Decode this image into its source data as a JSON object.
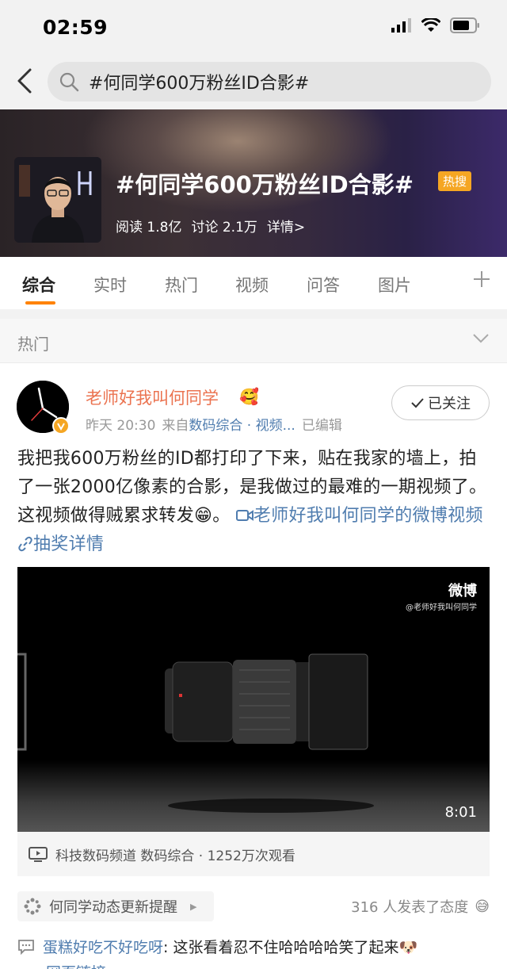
{
  "status_bar": {
    "time": "02:59"
  },
  "search": {
    "query": "#何同学600万粉丝ID合影#"
  },
  "banner": {
    "title": "#何同学600万粉丝ID合影#",
    "badge": "热搜",
    "reads": "阅读 1.8亿",
    "discussions": "讨论 2.1万",
    "details": "详情>"
  },
  "tabs": [
    {
      "label": "综合"
    },
    {
      "label": "实时"
    },
    {
      "label": "热门"
    },
    {
      "label": "视频"
    },
    {
      "label": "问答"
    },
    {
      "label": "图片"
    }
  ],
  "section": {
    "title": "热门"
  },
  "post": {
    "user_name": "老师好我叫何同学",
    "user_emoji": "🥰",
    "time": "昨天 20:30",
    "source_prefix": "来自",
    "source": "数码综合 · 视频...",
    "edited": "已编辑",
    "follow_label": "已关注",
    "text_main": "我把我600万粉丝的ID都打印了下来，贴在我家的墙上，拍了一张2000亿像素的合影，是我做过的最难的一期视频了。这视频做得贼累求转发",
    "text_emoji": "😁",
    "text_period": "。",
    "video_link": "老师好我叫何同学的微博视频",
    "lottery_link": "抽奖详情",
    "watermark_title": "微博",
    "watermark_sub": "@老师好我叫何同学",
    "video_duration": "8:01",
    "video_source": "科技数码频道 数码综合 · 1252万次观看"
  },
  "footer": {
    "remind_label": "何同学动态更新提醒",
    "attitude_text": "316 人发表了态度",
    "attitude_emoji": "😅",
    "comment_user": "蛋糕好吃不好吃呀",
    "comment_text": ": 这张看着忍不住哈哈哈哈笑了起来",
    "comment_emoji": "🐶",
    "comment_line2": "网页链接"
  }
}
